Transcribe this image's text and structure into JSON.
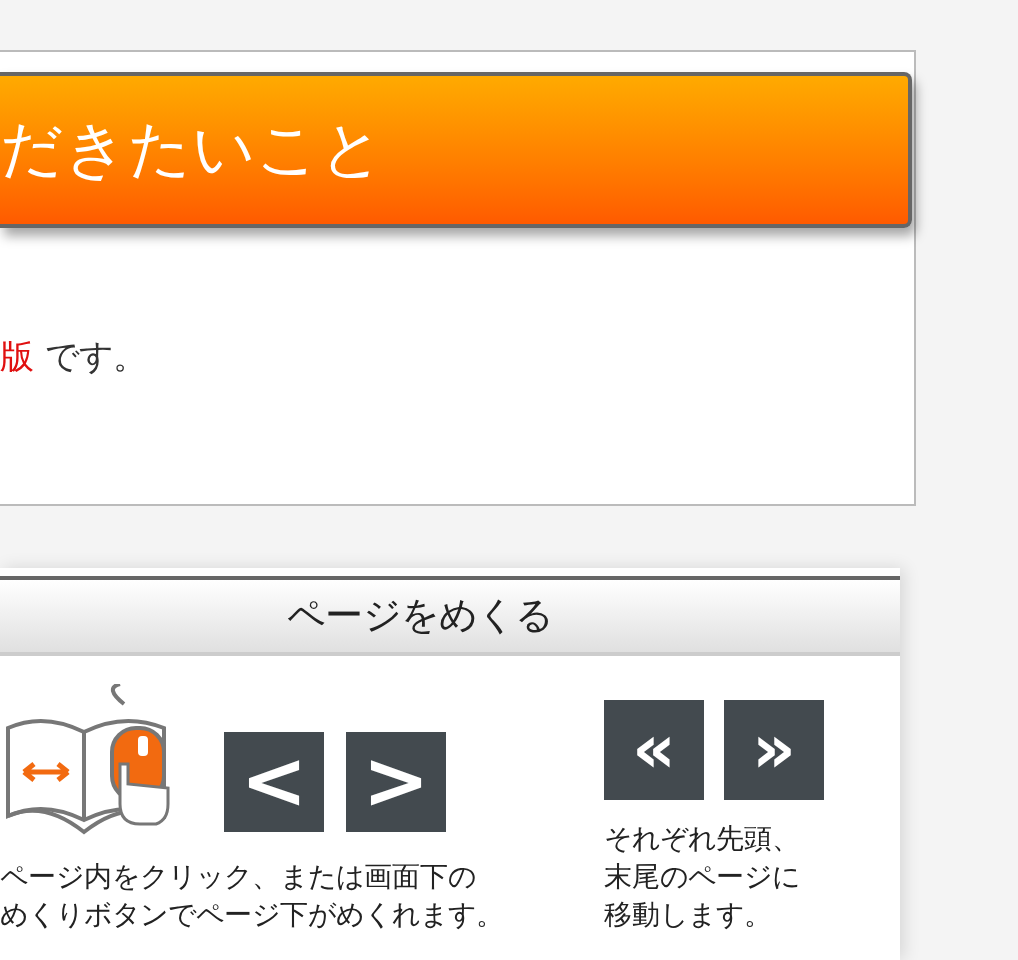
{
  "notice": {
    "title": "だきたいこと",
    "message": "**版** です。"
  },
  "page_turn": {
    "title": "ページをめくる",
    "buttons": [
      {
        "kind": "prev",
        "label": "<"
      },
      {
        "kind": "next",
        "label": ">"
      },
      {
        "kind": "first",
        "label": "«"
      },
      {
        "kind": "last",
        "label": "»"
      }
    ],
    "left_caption": [
      "ページ内をクリック、または画面下の",
      "めくりボタンでページ下がめくれます。"
    ],
    "right_caption": [
      "それぞれ先頭、",
      "末尾のページに",
      "移動します。"
    ]
  }
}
